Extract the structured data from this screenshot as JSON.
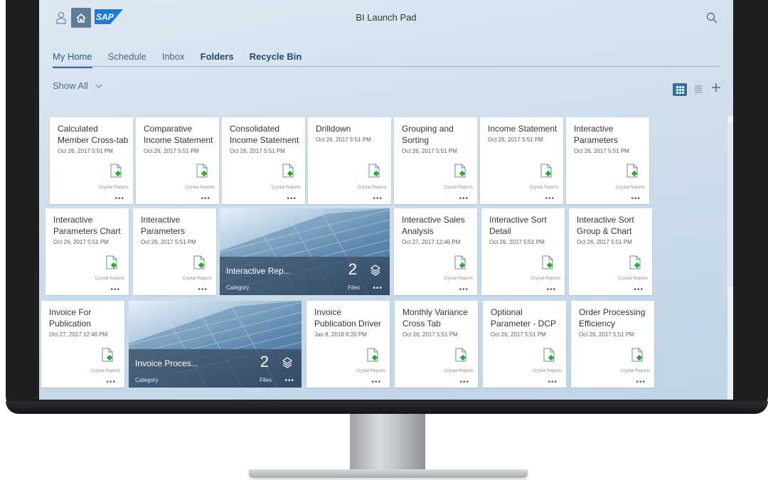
{
  "shell": {
    "app_title": "BI Launch Pad",
    "logo_text": "SAP",
    "accent_color": "#5f7d96"
  },
  "tabs": [
    {
      "label": "My Home"
    },
    {
      "label": "Schedule"
    },
    {
      "label": "Inbox"
    },
    {
      "label": "Folders"
    },
    {
      "label": "Recycle Bin"
    }
  ],
  "filter": {
    "label": "Show All"
  },
  "tiles": [
    {
      "title": "Calculated Member Cross-tab",
      "date": "Oct 26, 2017 5:51 PM",
      "type": "Crystal Reports"
    },
    {
      "title": "Comparative Income Statement",
      "date": "Oct 26, 2017 5:51 PM",
      "type": "Crystal Reports"
    },
    {
      "title": "Consolidated Income Statement",
      "date": "Oct 26, 2017 5:51 PM",
      "type": "Crystal Reports"
    },
    {
      "title": "Drilldown",
      "date": "Oct 26, 2017 5:51 PM",
      "type": "Crystal Reports"
    },
    {
      "title": "Grouping and Sorting",
      "date": "Oct 26, 2017 5:51 PM",
      "type": "Crystal Reports"
    },
    {
      "title": "Income Statement",
      "date": "Oct 26, 2017 5:51 PM",
      "type": "Crystal Reports"
    },
    {
      "title": "Interactive Parameters",
      "date": "Oct 26, 2017 5:51 PM",
      "type": "Crystal Reports"
    },
    {
      "title": "Interactive Parameters Chart",
      "date": "Oct 26, 2017 5:51 PM",
      "type": "Crystal Reports"
    },
    {
      "title": "Interactive Parameters",
      "date": "Oct 26, 2017 5:51 PM",
      "type": "Crystal Reports"
    },
    {
      "title": "Interactive Sales Analysis",
      "date": "Oct 27, 2017 12:46 PM",
      "type": "Crystal Reports"
    },
    {
      "title": "Interactive Sort Detail",
      "date": "Oct 26, 2017 5:51 PM",
      "type": "Crystal Reports"
    },
    {
      "title": "Interactive Sort Group & Chart",
      "date": "Oct 26, 2017 5:51 PM",
      "type": "Crystal Reports"
    },
    {
      "title": "Invoice For Publication",
      "date": "Oct 27, 2017 12:46 PM",
      "type": "Crystal Reports"
    },
    {
      "title": "Invoice Publication Driver",
      "date": "Jan 8, 2018 6:20 PM",
      "type": "Crystal Reports"
    },
    {
      "title": "Monthly Variance Cross Tab",
      "date": "Oct 26, 2017 5:51 PM",
      "type": "Crystal Reports"
    },
    {
      "title": "Optional Parameter - DCP",
      "date": "Oct 26, 2017 5:51 PM",
      "type": "Crystal Reports"
    },
    {
      "title": "Order Processing Efficiency",
      "date": "Oct 26, 2017 5:51 PM",
      "type": "Crystal Reports"
    }
  ],
  "categories": [
    {
      "name": "Interactive Rep...",
      "label": "Category",
      "count": "2",
      "files_label": "Files"
    },
    {
      "name": "Invoice Proces...",
      "label": "Category",
      "count": "2",
      "files_label": "Files"
    }
  ]
}
